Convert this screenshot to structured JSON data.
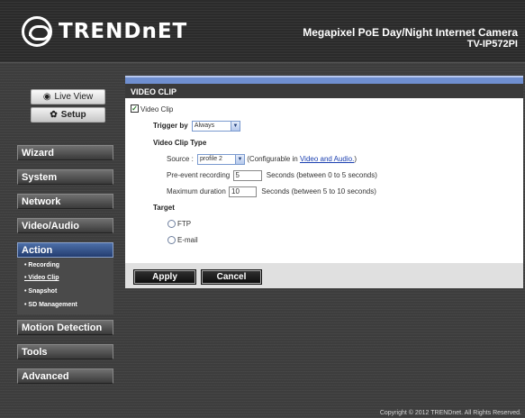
{
  "header": {
    "brand": "TRENDnET",
    "product": "Megapixel PoE Day/Night Internet Camera",
    "model": "TV-IP572PI"
  },
  "nav": {
    "live_view": "Live View",
    "setup": "Setup"
  },
  "menu": {
    "wizard": "Wizard",
    "system": "System",
    "network": "Network",
    "video_audio": "Video/Audio",
    "action": "Action",
    "motion": "Motion Detection",
    "tools": "Tools",
    "advanced": "Advanced"
  },
  "submenu": {
    "recording": "• Recording",
    "video_clip": "• Video Clip",
    "snapshot": "• Snapshot",
    "sd": "• SD Management"
  },
  "page": {
    "title": "VIDEO CLIP",
    "enable_label": "Video Clip",
    "enabled": true,
    "trigger_label": "Trigger by",
    "trigger_value": "Always",
    "type_heading": "Video Clip Type",
    "source_label": "Source :",
    "source_value": "profile 2",
    "configurable_prefix": "(Configurable in ",
    "configurable_link": "Video and Audio.",
    "configurable_suffix": ")",
    "pre_event_label": "Pre-event recording",
    "pre_event_value": "5",
    "pre_event_hint": "Seconds (between 0 to 5 seconds)",
    "max_dur_label": "Maximum duration",
    "max_dur_value": "10",
    "max_dur_hint": "Seconds (between 5 to 10 seconds)",
    "target_heading": "Target",
    "target_ftp": "FTP",
    "target_email": "E-mail"
  },
  "buttons": {
    "apply": "Apply",
    "cancel": "Cancel"
  },
  "footer": "Copyright © 2012 TRENDnet. All Rights Reserved."
}
